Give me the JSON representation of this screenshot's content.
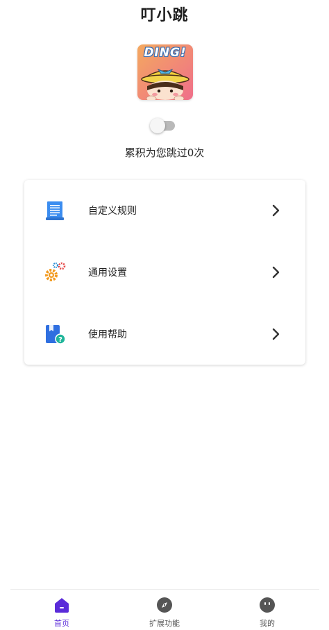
{
  "app": {
    "title": "叮小跳",
    "logo_text": "DING!"
  },
  "service_toggle": {
    "enabled": false
  },
  "counter_text": "累积为您跳过0次",
  "menu": [
    {
      "label": "自定义规则",
      "icon": "document-list-icon"
    },
    {
      "label": "通用设置",
      "icon": "gears-icon"
    },
    {
      "label": "使用帮助",
      "icon": "help-book-icon"
    }
  ],
  "bottom_nav": [
    {
      "label": "首页",
      "icon": "home-icon",
      "active": true
    },
    {
      "label": "扩展功能",
      "icon": "compass-icon",
      "active": false
    },
    {
      "label": "我的",
      "icon": "face-icon",
      "active": false
    }
  ],
  "colors": {
    "accent": "#5a2bd9",
    "toggle_off_track": "#b9b9b9",
    "card_border": "#e6e6e6"
  }
}
